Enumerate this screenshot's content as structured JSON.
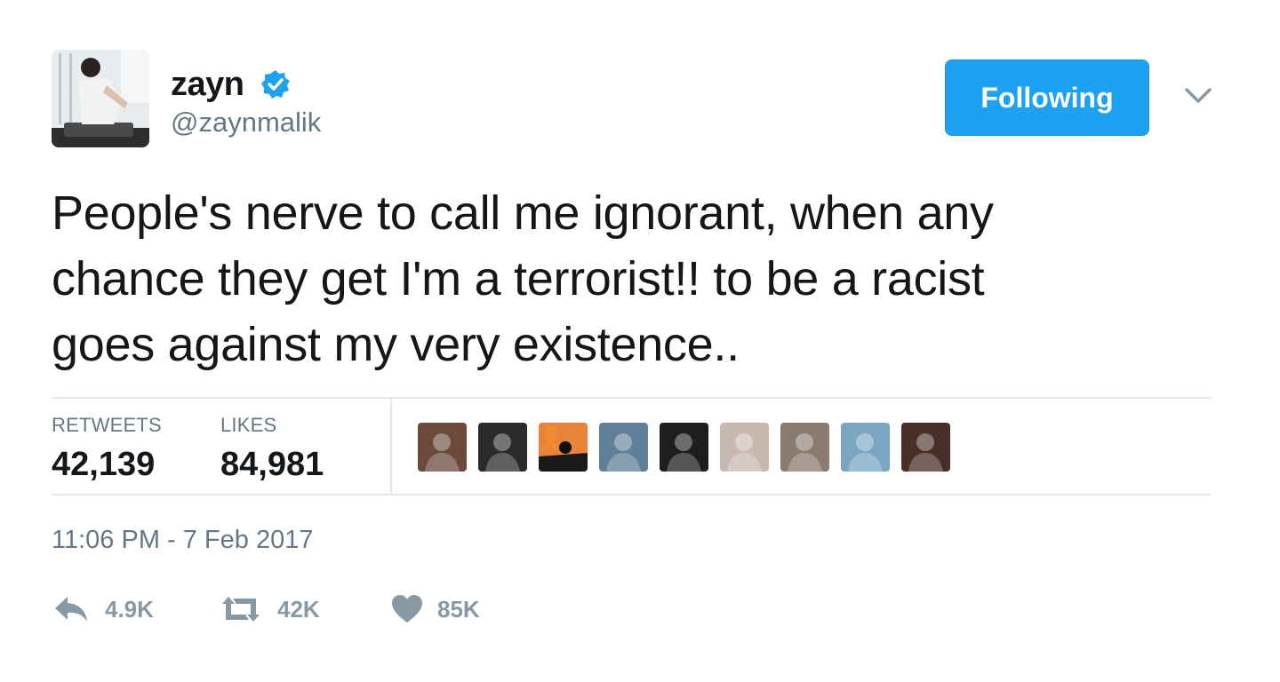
{
  "user": {
    "display_name": "zayn",
    "handle": "@zaynmalik",
    "verified": true
  },
  "follow_button": {
    "label": "Following"
  },
  "tweet": {
    "lines": [
      "People's nerve to call me ignorant, when any",
      "chance they get I'm a terrorist!! to be a racist",
      "goes against my very existence.."
    ]
  },
  "stats": {
    "retweets_label": "RETWEETS",
    "retweets_value": "42,139",
    "likes_label": "LIKES",
    "likes_value": "84,981"
  },
  "liker_avatars": [
    {
      "icon": "user-avatar-icon",
      "color": "#6b4a3a"
    },
    {
      "icon": "user-avatar-icon",
      "color": "#2b2b2b"
    },
    {
      "icon": "ribbon-avatar-icon",
      "color": "#e8833a"
    },
    {
      "icon": "user-avatar-icon",
      "color": "#5f7f9a"
    },
    {
      "icon": "user-avatar-icon",
      "color": "#1e1e1e"
    },
    {
      "icon": "user-avatar-icon",
      "color": "#c9b8b0"
    },
    {
      "icon": "user-avatar-icon",
      "color": "#8a7a70"
    },
    {
      "icon": "user-avatar-icon",
      "color": "#7aa6c4"
    },
    {
      "icon": "user-avatar-icon",
      "color": "#4a2e28"
    }
  ],
  "timestamp": "11:06 PM - 7 Feb 2017",
  "actions": {
    "reply_count": "4.9K",
    "retweet_count": "42K",
    "like_count": "85K"
  },
  "colors": {
    "accent": "#1da1f2",
    "text": "#14171a",
    "muted": "#657786",
    "icon_gray": "#8899a6",
    "divider": "#e1e8ed"
  },
  "icons": {
    "verified": "verified-badge-icon",
    "caret": "chevron-down-icon",
    "reply": "reply-icon",
    "retweet": "retweet-icon",
    "like": "heart-icon"
  }
}
